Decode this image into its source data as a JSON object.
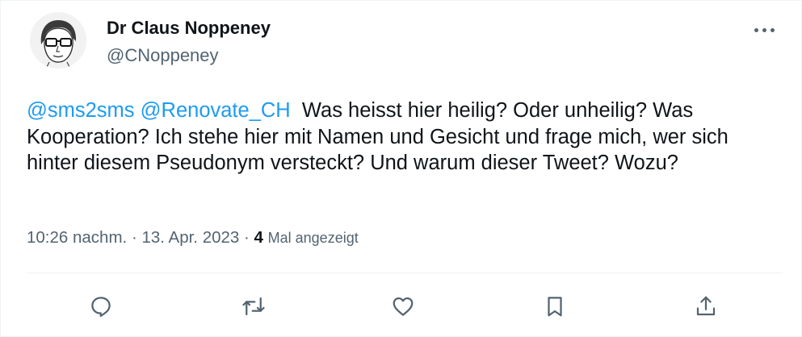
{
  "author": {
    "name": "Dr Claus Noppeney",
    "handle": "@CNoppeney",
    "avatar_icon": "person-sketch-icon"
  },
  "tweet": {
    "mentions": [
      "@sms2sms",
      "@Renovate_CH"
    ],
    "body": "Was heisst hier heilig? Oder unheilig? Was Kooperation? Ich stehe hier mit Namen und Gesicht und frage mich, wer sich hinter diesem Pseudonym versteckt? Und warum dieser Tweet? Wozu?"
  },
  "meta": {
    "time": "10:26 nachm.",
    "separator": "·",
    "date": "13. Apr. 2023",
    "views_count": "4",
    "views_label": "Mal angezeigt"
  },
  "actions": {
    "reply_icon": "reply-icon",
    "retweet_icon": "retweet-icon",
    "like_icon": "heart-icon",
    "bookmark_icon": "bookmark-icon",
    "share_icon": "share-icon"
  },
  "colors": {
    "link": "#1d9bf0",
    "secondary_text": "#536471",
    "primary_text": "#0f1419",
    "border": "#eff3f4"
  }
}
